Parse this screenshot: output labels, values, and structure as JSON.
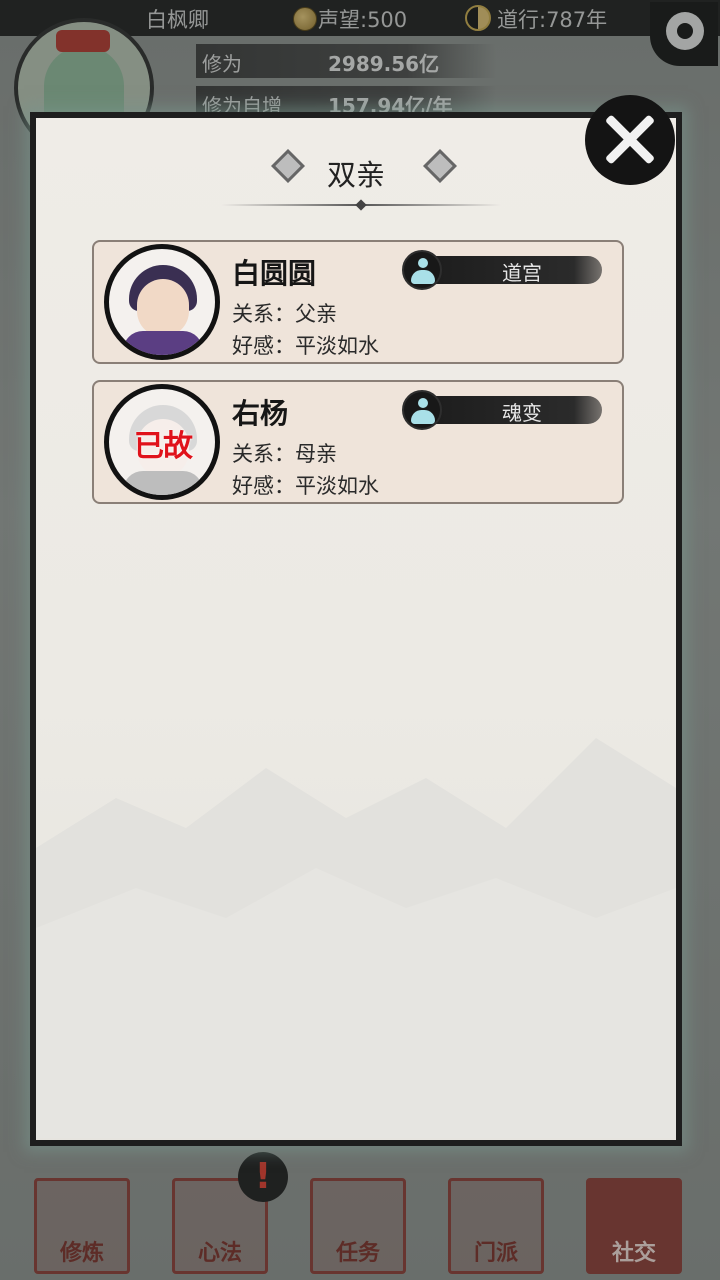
{
  "top_bar": {
    "player_name": "白枫卿",
    "prestige": "声望:500",
    "daoxing": "道行:787年"
  },
  "stats": {
    "cultivation_label": "修为",
    "cultivation_value": "2989.56亿",
    "growth_label": "修为自增",
    "growth_value": "157.94亿/年"
  },
  "dialog": {
    "title": "双亲",
    "members": [
      {
        "name": "白圆圆",
        "relation": "关系：父亲",
        "affinity": "好感：平淡如水",
        "realm": "道宫",
        "deceased_label": ""
      },
      {
        "name": "右杨",
        "relation": "关系：母亲",
        "affinity": "好感：平淡如水",
        "realm": "魂变",
        "deceased_label": "已故"
      }
    ]
  },
  "bottom_nav": {
    "items": [
      {
        "label": "修炼"
      },
      {
        "label": "心法"
      },
      {
        "label": "任务"
      },
      {
        "label": "门派"
      },
      {
        "label": "社交"
      }
    ],
    "active": "社交",
    "alert_mark": "!"
  },
  "colors": {
    "seal_red": "#8b3a33",
    "deceased_red": "#e0121b",
    "panel_bg": "#efece7",
    "card_bg": "#efe4da"
  }
}
